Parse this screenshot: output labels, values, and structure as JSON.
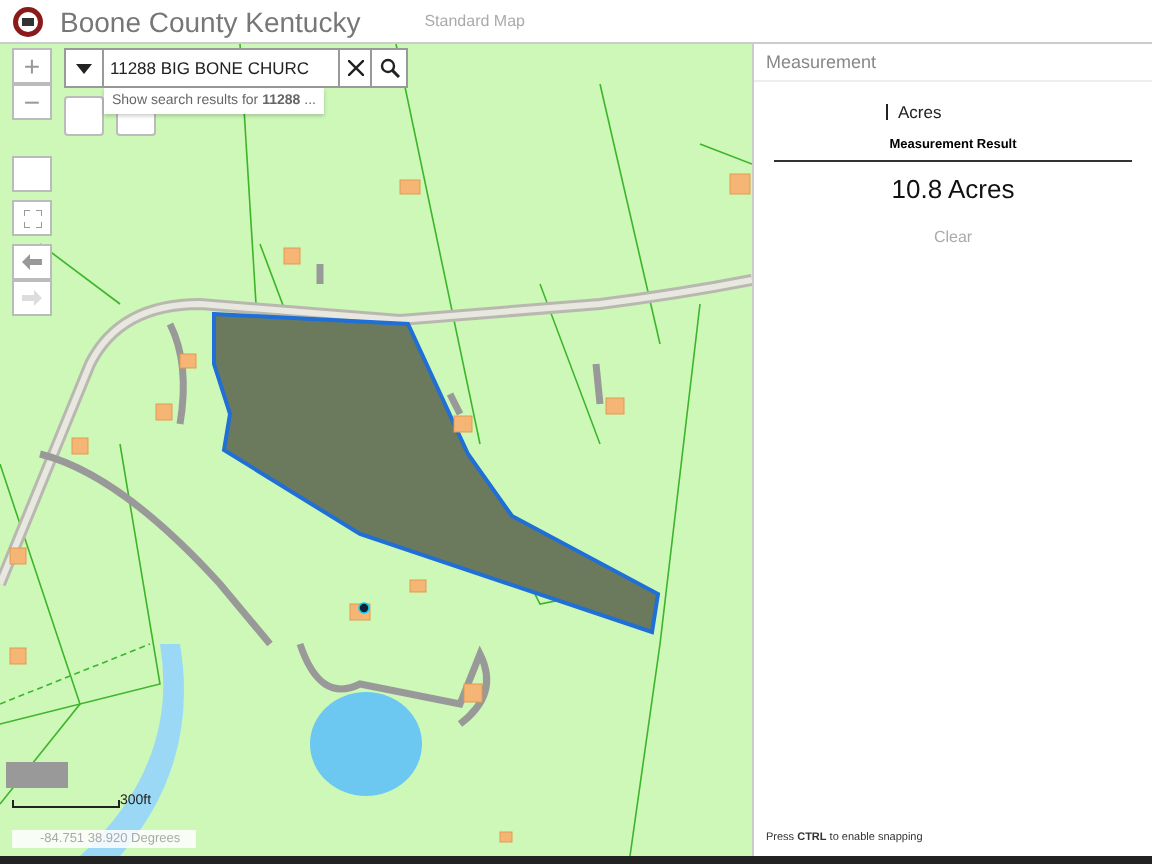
{
  "header": {
    "title": "Boone County Kentucky",
    "subtitle": "Standard Map"
  },
  "search": {
    "value": "11288 BIG BONE CHURC",
    "suggestion": "Show search results for **11288** ..."
  },
  "zoom_controls": [
    {
      "label": "+"
    },
    {
      "label": "−"
    }
  ],
  "nav": [
    {
      "kind": "back",
      "disabled": false
    },
    {
      "kind": "forward",
      "disabled": true
    }
  ],
  "map": {
    "scale": "300ft",
    "coordinates": "-84.751 38.920 Degrees"
  },
  "panel": {
    "title": "Measurement",
    "unit": "Acres",
    "result_label": "Measurement Result",
    "result": "10.8 Acres",
    "clear": "Clear",
    "hint": "Press **CTRL** to enable snapping"
  }
}
